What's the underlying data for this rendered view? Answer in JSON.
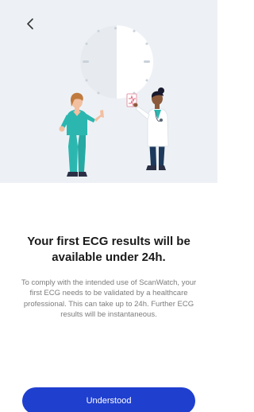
{
  "header": {
    "back_icon": "chevron-left-icon"
  },
  "illustration": {
    "subject": "clock-with-patient-and-doctor",
    "colors": {
      "background": "#edf1f5",
      "clock_face": "#ffffff",
      "clock_shade": "#e7ebef",
      "scrubs": "#2bb7b0",
      "doctor_pants": "#1d3a5c",
      "skin": "#f2bfa0"
    }
  },
  "content": {
    "title": "Your first ECG results will be available under 24h.",
    "description": "To comply with the intended use of ScanWatch, your first ECG needs to be validated by a healthcare professional. This can take up to 24h. Further ECG results will be instantaneous."
  },
  "actions": {
    "primary_label": "Understood",
    "primary_color": "#1f3fcf"
  }
}
